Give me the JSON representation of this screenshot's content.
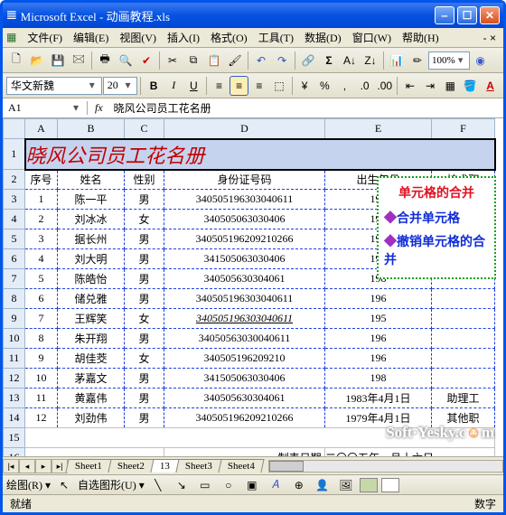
{
  "window": {
    "title": "Microsoft Excel - 动画教程.xls"
  },
  "menu": {
    "file": "文件(F)",
    "edit": "编辑(E)",
    "view": "视图(V)",
    "insert": "插入(I)",
    "format": "格式(O)",
    "tools": "工具(T)",
    "data": "数据(D)",
    "window": "窗口(W)",
    "help": "帮助(H)"
  },
  "toolbar": {
    "zoom": "100%",
    "font": "华文新魏",
    "size": "20"
  },
  "formula": {
    "cell": "A1",
    "value": "晓风公司员工花名册"
  },
  "cols": [
    "A",
    "B",
    "C",
    "D",
    "E",
    "F"
  ],
  "title_cell": "晓风公司员工花名册",
  "headers": {
    "a": "序号",
    "b": "姓名",
    "c": "性别",
    "d": "身份证号码",
    "e": "出生年月",
    "f": "技术职"
  },
  "rows": [
    {
      "n": "1",
      "name": "陈一平",
      "sex": "男",
      "id": "340505196303040611",
      "dob": "196"
    },
    {
      "n": "2",
      "name": "刘冰冰",
      "sex": "女",
      "id": "340505063030406",
      "dob": "196"
    },
    {
      "n": "3",
      "name": "据长州",
      "sex": "男",
      "id": "340505196209210266",
      "dob": "197"
    },
    {
      "n": "4",
      "name": "刘大明",
      "sex": "男",
      "id": "341505063030406",
      "dob": "196"
    },
    {
      "n": "5",
      "name": "陈皓怡",
      "sex": "男",
      "id": "340505630304061",
      "dob": "198"
    },
    {
      "n": "6",
      "name": "储兑雅",
      "sex": "男",
      "id": "340505196303040611",
      "dob": "196"
    },
    {
      "n": "7",
      "name": "王辉笑",
      "sex": "女",
      "id": "340505196303040611",
      "dob": "195"
    },
    {
      "n": "8",
      "name": "朱开翔",
      "sex": "男",
      "id": "34050563030040611",
      "dob": "196"
    },
    {
      "n": "9",
      "name": "胡佳茭",
      "sex": "女",
      "id": "340505196209210",
      "dob": "196"
    },
    {
      "n": "10",
      "name": "茅嘉文",
      "sex": "男",
      "id": "341505063030406",
      "dob": "198"
    },
    {
      "n": "11",
      "name": "黄嘉伟",
      "sex": "男",
      "id": "340505630304061",
      "dob": "1983年4月1日",
      "f": "助理工"
    },
    {
      "n": "12",
      "name": "刘劲伟",
      "sex": "男",
      "id": "340505196209210266",
      "dob": "1979年4月1日",
      "f": "其他职"
    }
  ],
  "footer": {
    "d": "制表日期:",
    "e": "二〇〇五年一月十六日"
  },
  "tabs": {
    "t1": "Sheet1",
    "t2": "Sheet2",
    "t3": "13",
    "t4": "Sheet3",
    "t5": "Sheet4"
  },
  "callout": {
    "title": "单元格的合并",
    "i1": "合并单元格",
    "i2": "撤销单元格的合并"
  },
  "draw": {
    "label": "绘图(R)",
    "auto": "自选图形(U)"
  },
  "status": {
    "l": "就绪",
    "r": "数字"
  },
  "watermark": "Soft·Yesky.c   m"
}
